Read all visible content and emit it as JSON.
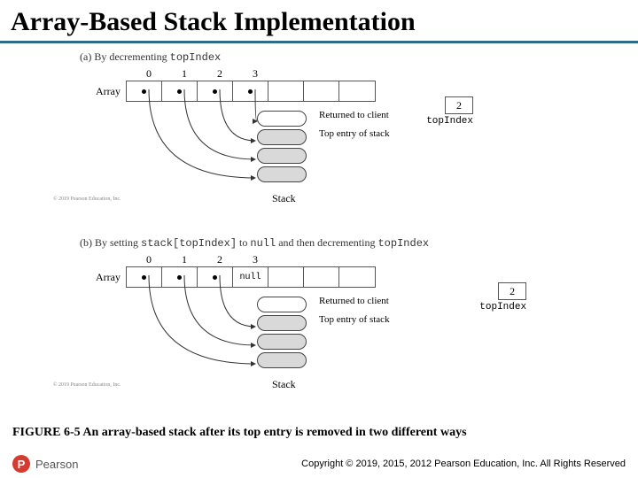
{
  "title": "Array-Based Stack Implementation",
  "caption": "FIGURE 6-5 An array-based stack after its top entry is removed in two different ways",
  "footer": {
    "brand": "Pearson",
    "copyright": "Copyright © 2019, 2015, 2012 Pearson Education, Inc. All Rights Reserved"
  },
  "fineprint": "© 2019 Pearson Education, Inc.",
  "labels": {
    "array": "Array",
    "returned": "Returned to client",
    "topentry": "Top entry of stack",
    "stack": "Stack",
    "topindex": "topIndex",
    "null": "null"
  },
  "subfigs": {
    "a": {
      "caption_prefix": "(a) By decrementing ",
      "caption_mono": "topIndex",
      "indices": [
        "0",
        "1",
        "2",
        "3"
      ],
      "cells": [
        "dot",
        "dot",
        "dot",
        "dot",
        "",
        "",
        ""
      ],
      "topindex_value": "2",
      "stack_slots": [
        "ghost",
        "filled",
        "filled",
        "filled"
      ]
    },
    "b": {
      "caption_prefix": "(b) By setting ",
      "caption_mono1": "stack[topIndex]",
      "caption_mid": " to ",
      "caption_mono2": "null",
      "caption_suffix": " and then decrementing ",
      "caption_mono3": "topIndex",
      "indices": [
        "0",
        "1",
        "2",
        "3"
      ],
      "cells": [
        "dot",
        "dot",
        "dot",
        "null",
        "",
        "",
        ""
      ],
      "topindex_value": "2",
      "stack_slots": [
        "ghost",
        "filled",
        "filled",
        "filled"
      ]
    }
  }
}
